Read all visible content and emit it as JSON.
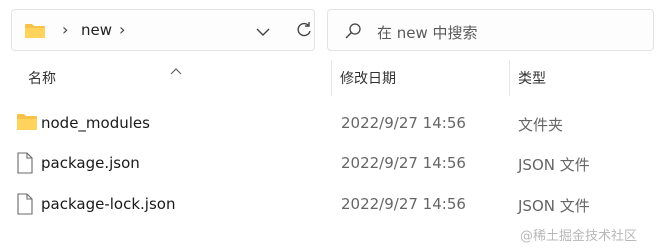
{
  "address": {
    "crumb": "new",
    "separator": "›"
  },
  "search": {
    "placeholder": "在 new 中搜索"
  },
  "columns": {
    "name": "名称",
    "modified": "修改日期",
    "type": "类型"
  },
  "files": [
    {
      "name": "node_modules",
      "modified": "2022/9/27 14:56",
      "type": "文件夹",
      "icon": "folder-icon"
    },
    {
      "name": "package.json",
      "modified": "2022/9/27 14:56",
      "type": "JSON 文件",
      "icon": "file-icon"
    },
    {
      "name": "package-lock.json",
      "modified": "2022/9/27 14:56",
      "type": "JSON 文件",
      "icon": "file-icon"
    }
  ],
  "watermark": "@稀土掘金技术社区",
  "colors": {
    "folder": "#f8c14b",
    "folder_dark": "#e8a92f",
    "border": "#e3e3e3"
  }
}
